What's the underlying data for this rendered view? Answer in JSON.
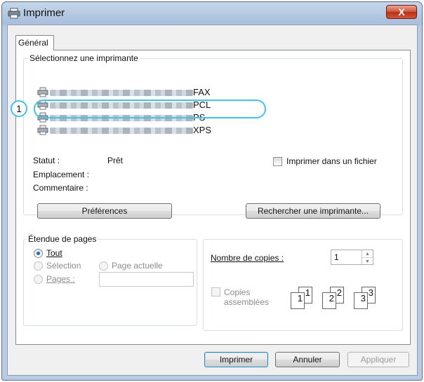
{
  "window": {
    "title": "Imprimer",
    "close_label": "X"
  },
  "tabs": [
    {
      "label": "Général"
    }
  ],
  "printer_group": {
    "legend": "Sélectionnez une imprimante",
    "printers": [
      {
        "suffix": "FAX"
      },
      {
        "suffix": "PCL"
      },
      {
        "suffix": "PS",
        "selected": true
      },
      {
        "suffix": "XPS"
      }
    ],
    "callout_number": "1",
    "status_label": "Statut :",
    "status_value": "Prêt",
    "location_label": "Emplacement :",
    "comment_label": "Commentaire :",
    "print_to_file_label": "Imprimer dans un fichier",
    "preferences_button": "Préférences",
    "find_printer_button": "Rechercher une imprimante..."
  },
  "page_range": {
    "legend": "Étendue de pages",
    "all_label": "Tout",
    "selection_label": "Sélection",
    "current_page_label": "Page actuelle",
    "pages_label": "Pages :",
    "pages_value": ""
  },
  "copies": {
    "label": "Nombre de copies :",
    "value": "1",
    "collate_label_line1": "Copies",
    "collate_label_line2": "assemblées",
    "collate_pages": [
      "1",
      "1",
      "2",
      "2",
      "3",
      "3"
    ]
  },
  "footer": {
    "print_button": "Imprimer",
    "cancel_button": "Annuler",
    "apply_button": "Appliquer"
  }
}
